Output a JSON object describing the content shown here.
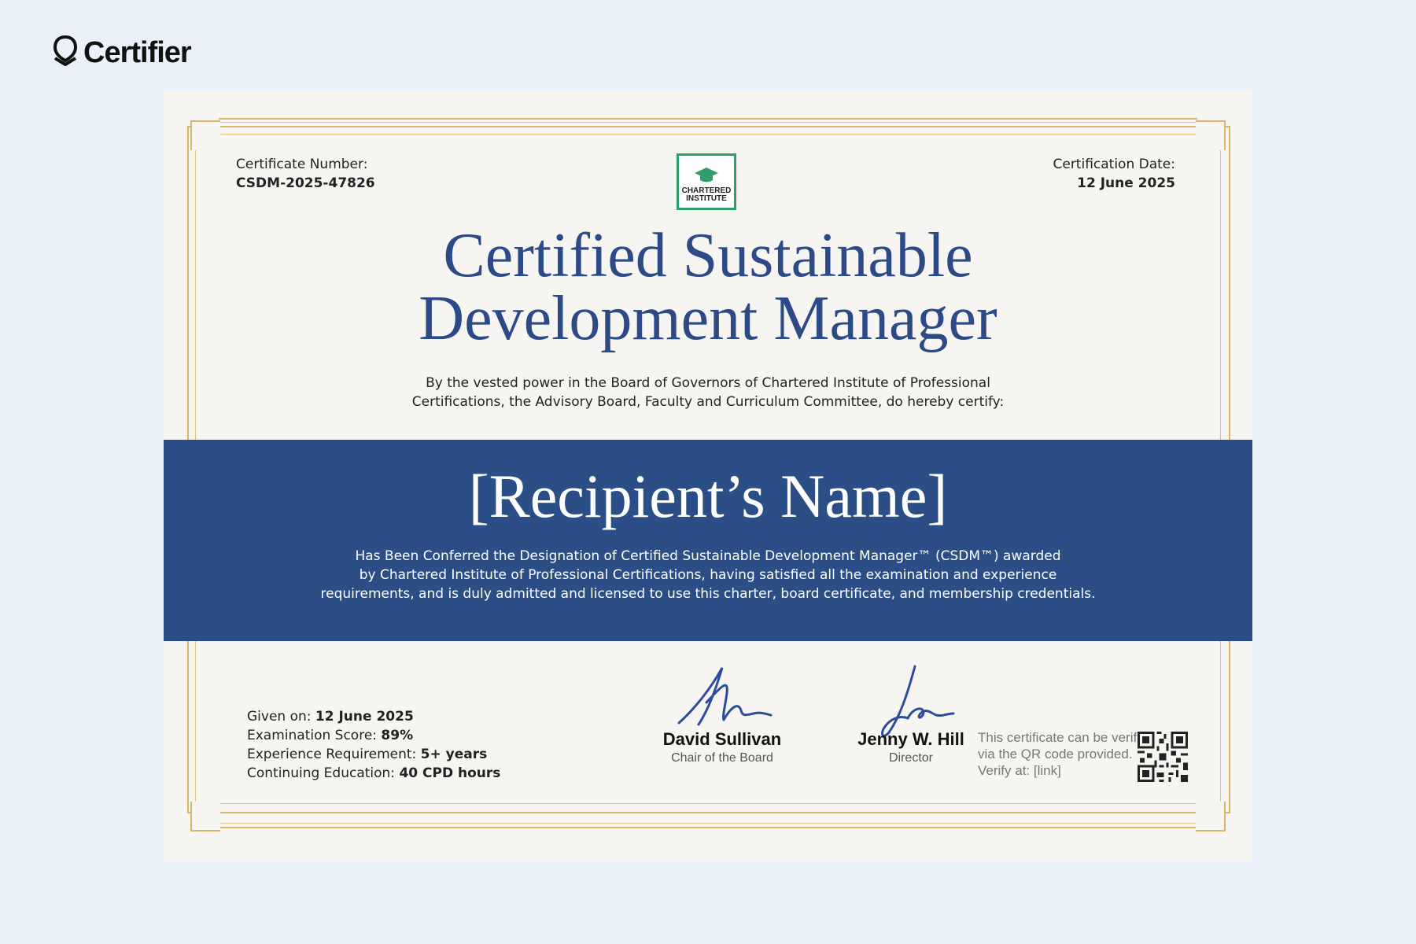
{
  "brand": {
    "name": "Certifier"
  },
  "certificate": {
    "number_label": "Certificate Number:",
    "number_value": "CSDM-2025-47826",
    "date_label": "Certification Date:",
    "date_value": "12 June 2025",
    "logo_text_line1": "CHARTERED",
    "logo_text_line2": "INSTITUTE",
    "title_line1": "Certified Sustainable",
    "title_line2": "Development Manager",
    "subtitle_line1": "By the vested power in the Board of Governors of Chartered Institute of Professional",
    "subtitle_line2": "Certifications, the Advisory Board, Faculty and Curriculum Committee, do hereby certify:",
    "recipient": "[Recipient’s Name]",
    "conferred_line1": "Has Been Conferred the Designation of Certified Sustainable Development Manager™ (CSDM™) awarded",
    "conferred_line2": "by Chartered Institute of Professional Certifications, having satisfied all the examination and experience",
    "conferred_line3": "requirements, and is duly admitted and licensed to use this charter, board certificate, and membership credentials.",
    "details": [
      {
        "label": "Given on: ",
        "value": "12 June 2025"
      },
      {
        "label": "Examination Score: ",
        "value": "89%"
      },
      {
        "label": "Experience Requirement: ",
        "value": "5+ years"
      },
      {
        "label": "Continuing Education: ",
        "value": "40 CPD hours"
      }
    ],
    "signatories": [
      {
        "name": "David Sullivan",
        "role": "Chair of the Board"
      },
      {
        "name": "Jenny W. Hill",
        "role": "Director"
      }
    ],
    "verify_line1": "This certificate can be verified",
    "verify_line2": "via the QR code provided.",
    "verify_line3": "Verify at: [link]"
  },
  "colors": {
    "navy": "#2c4e87",
    "gold": "#d8b56a",
    "green": "#2e9e6b",
    "background": "#eaf1fb"
  }
}
